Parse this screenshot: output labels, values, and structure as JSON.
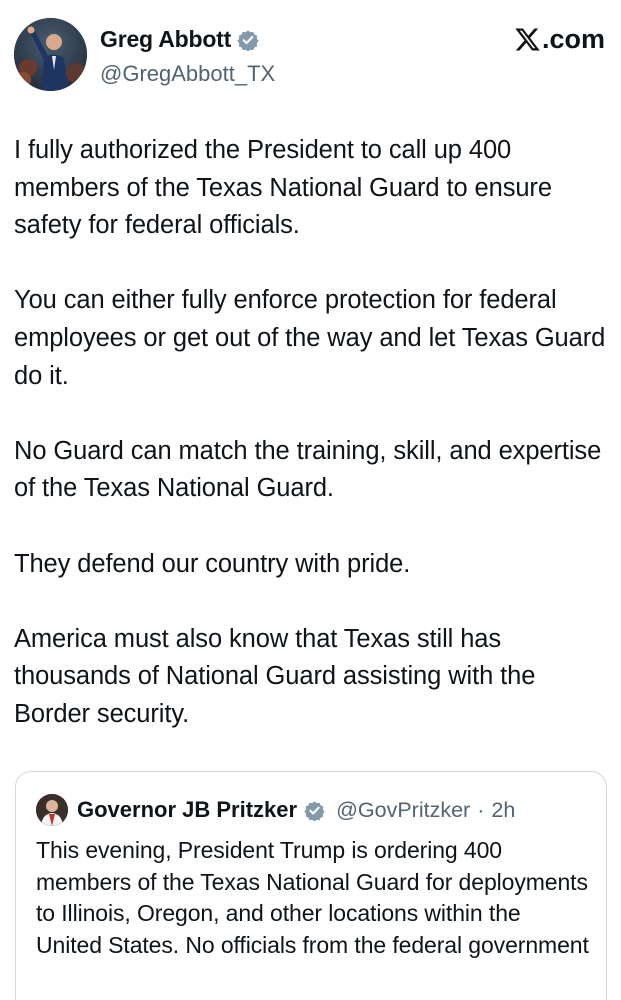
{
  "author": {
    "display_name": "Greg Abbott",
    "handle": "@GregAbbott_TX",
    "verified": true,
    "avatar_icon": "profile-photo"
  },
  "brand": {
    "label": ".com",
    "icon": "x-logo-icon"
  },
  "tweet": {
    "paragraphs": [
      "I fully authorized the President to call up 400 members of the Texas National Guard to ensure safety for federal officials.",
      "You can either fully enforce protection for federal employees or get out of the way and let Texas Guard do it.",
      "No Guard can match the training, skill, and expertise of the Texas National Guard.",
      "They defend our country with pride.",
      "America must also know that Texas still has thousands of National Guard assisting with the Border security."
    ]
  },
  "quoted": {
    "display_name": "Governor JB Pritzker",
    "handle": "@GovPritzker",
    "separator": "·",
    "time": "2h",
    "verified": true,
    "text": "This evening, President Trump is ordering 400 members of the Texas National Guard for deployments to Illinois, Oregon, and other locations within the United States. No officials from the federal government called me directly t..."
  },
  "colors": {
    "text_primary": "#0f1419",
    "text_secondary": "#536471",
    "verified_badge": "#829aab",
    "border": "#cfd9de"
  }
}
